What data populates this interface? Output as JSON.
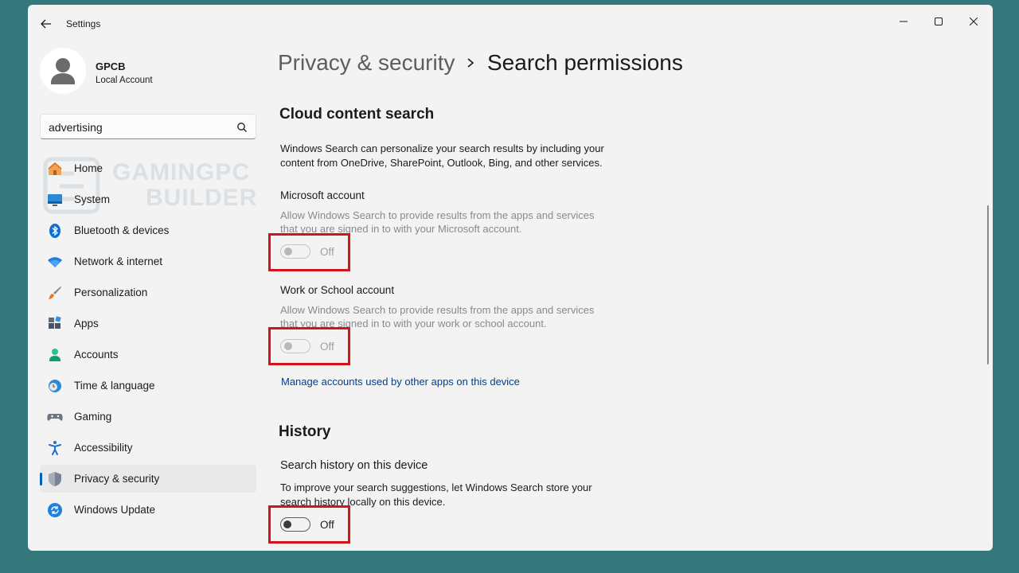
{
  "window": {
    "title": "Settings"
  },
  "user": {
    "name": "GPCB",
    "account_type": "Local Account"
  },
  "search": {
    "value": "advertising"
  },
  "watermark": {
    "line1": "GAMINGPC",
    "line2": "BUILDER"
  },
  "sidebar": {
    "items": [
      {
        "label": "Home",
        "icon": "home-icon"
      },
      {
        "label": "System",
        "icon": "monitor-icon"
      },
      {
        "label": "Bluetooth & devices",
        "icon": "bluetooth-icon"
      },
      {
        "label": "Network & internet",
        "icon": "wifi-icon"
      },
      {
        "label": "Personalization",
        "icon": "brush-icon"
      },
      {
        "label": "Apps",
        "icon": "apps-icon"
      },
      {
        "label": "Accounts",
        "icon": "person-icon"
      },
      {
        "label": "Time & language",
        "icon": "globe-clock-icon"
      },
      {
        "label": "Gaming",
        "icon": "gamepad-icon"
      },
      {
        "label": "Accessibility",
        "icon": "accessibility-icon"
      },
      {
        "label": "Privacy & security",
        "icon": "shield-icon",
        "selected": true
      },
      {
        "label": "Windows Update",
        "icon": "update-icon"
      }
    ]
  },
  "breadcrumb": {
    "parent": "Privacy & security",
    "current": "Search permissions"
  },
  "cloud": {
    "title": "Cloud content search",
    "description_line1": "Windows Search can personalize your search results by including your",
    "description_line2": "content from OneDrive, SharePoint, Outlook, Bing, and other services.",
    "microsoft": {
      "label": "Microsoft account",
      "desc_line1": "Allow Windows Search to provide results from the apps and services",
      "desc_line2": "that you are signed in to with your Microsoft account.",
      "state": "Off"
    },
    "work": {
      "label": "Work or School account",
      "desc_line1": "Allow Windows Search to provide results from the apps and services",
      "desc_line2": "that you are signed in to with your work or school account.",
      "state": "Off"
    },
    "manage_link": "Manage accounts used by other apps on this device"
  },
  "history": {
    "title": "History",
    "label": "Search history on this device",
    "desc_line1": "To improve your search suggestions, let Windows Search store your",
    "desc_line2": "search history locally on this device.",
    "state": "Off"
  },
  "colors": {
    "accent": "#005fb8",
    "highlight": "#d3141c",
    "link": "#003e92",
    "background": "#35787c"
  }
}
